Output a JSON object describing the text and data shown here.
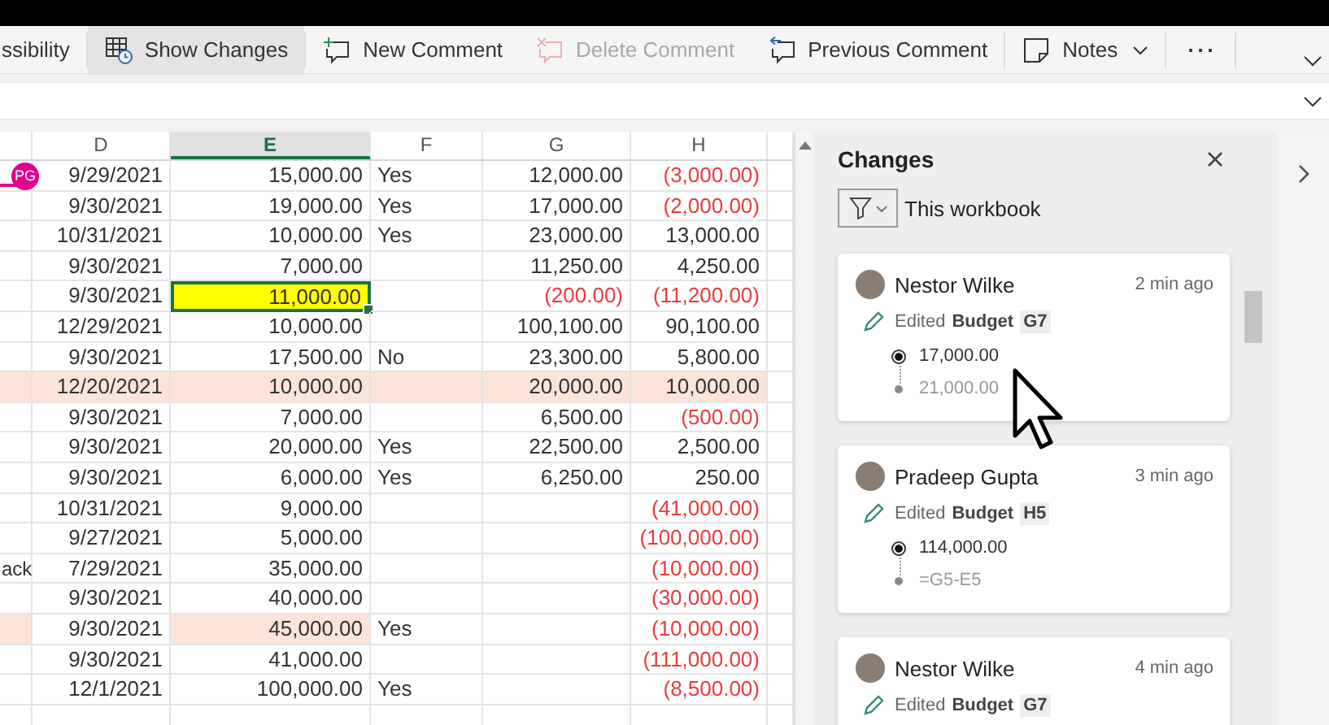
{
  "ribbon": {
    "cut_label": "ssibility",
    "buttons": [
      {
        "kind": "changes",
        "label": "Show Changes",
        "selected": true,
        "disabled": false
      },
      {
        "kind": "new-comment",
        "label": "New Comment",
        "selected": false,
        "disabled": false
      },
      {
        "kind": "delete-comment",
        "label": "Delete Comment",
        "selected": false,
        "disabled": true
      },
      {
        "kind": "previous-comment",
        "label": "Previous Comment",
        "selected": false,
        "disabled": false
      },
      {
        "kind": "notes",
        "label": "Notes",
        "selected": false,
        "disabled": false
      }
    ],
    "more": "⋯"
  },
  "sheet": {
    "columns": [
      {
        "selected": false
      },
      {
        "label": "D",
        "selected": false
      },
      {
        "label": "E",
        "selected": true
      },
      {
        "label": "F",
        "selected": false
      },
      {
        "label": "G",
        "selected": false
      },
      {
        "label": "H",
        "selected": false
      }
    ],
    "rows": [
      {
        "presence": {
          "initials": "PG"
        },
        "cells": [
          {
            "highlighted": false,
            "selected": false
          },
          {
            "text": "9/29/2021",
            "negative": false,
            "highlighted": false,
            "selected": false
          },
          {
            "text": "15,000.00",
            "negative": false,
            "highlighted": false,
            "selected": false
          },
          {
            "text": "Yes",
            "negative": false,
            "highlighted": false,
            "selected": false
          },
          {
            "text": "12,000.00",
            "negative": false,
            "highlighted": false,
            "selected": false
          },
          {
            "text": "(3,000.00)",
            "negative": true,
            "highlighted": false,
            "selected": false
          }
        ]
      },
      {
        "cells": [
          {
            "highlighted": false,
            "selected": false
          },
          {
            "text": "9/30/2021",
            "negative": false,
            "highlighted": false,
            "selected": false
          },
          {
            "text": "19,000.00",
            "negative": false,
            "highlighted": false,
            "selected": false
          },
          {
            "text": "Yes",
            "negative": false,
            "highlighted": false,
            "selected": false
          },
          {
            "text": "17,000.00",
            "negative": false,
            "highlighted": false,
            "selected": false
          },
          {
            "text": "(2,000.00)",
            "negative": true,
            "highlighted": false,
            "selected": false
          }
        ]
      },
      {
        "cells": [
          {
            "highlighted": false,
            "selected": false
          },
          {
            "text": "10/31/2021",
            "negative": false,
            "highlighted": false,
            "selected": false
          },
          {
            "text": "10,000.00",
            "negative": false,
            "highlighted": false,
            "selected": false
          },
          {
            "text": "Yes",
            "negative": false,
            "highlighted": false,
            "selected": false
          },
          {
            "text": "23,000.00",
            "negative": false,
            "highlighted": false,
            "selected": false
          },
          {
            "text": "13,000.00",
            "negative": false,
            "highlighted": false,
            "selected": false
          }
        ]
      },
      {
        "cells": [
          {
            "highlighted": false,
            "selected": false
          },
          {
            "text": "9/30/2021",
            "negative": false,
            "highlighted": false,
            "selected": false
          },
          {
            "text": "7,000.00",
            "negative": false,
            "highlighted": false,
            "selected": false
          },
          {
            "highlighted": false,
            "selected": false
          },
          {
            "text": "11,250.00",
            "negative": false,
            "highlighted": false,
            "selected": false
          },
          {
            "text": "4,250.00",
            "negative": false,
            "highlighted": false,
            "selected": false
          }
        ]
      },
      {
        "cells": [
          {
            "highlighted": false,
            "selected": false
          },
          {
            "text": "9/30/2021",
            "negative": false,
            "highlighted": false,
            "selected": false
          },
          {
            "text": "11,000.00",
            "negative": false,
            "highlighted": false,
            "selected": true
          },
          {
            "highlighted": false,
            "selected": false
          },
          {
            "text": "(200.00)",
            "negative": true,
            "highlighted": false,
            "selected": false
          },
          {
            "text": "(11,200.00)",
            "negative": true,
            "highlighted": false,
            "selected": false
          }
        ]
      },
      {
        "cells": [
          {
            "highlighted": false,
            "selected": false
          },
          {
            "text": "12/29/2021",
            "negative": false,
            "highlighted": false,
            "selected": false
          },
          {
            "text": "10,000.00",
            "negative": false,
            "highlighted": false,
            "selected": false
          },
          {
            "highlighted": false,
            "selected": false
          },
          {
            "text": "100,100.00",
            "negative": false,
            "highlighted": false,
            "selected": false
          },
          {
            "text": "90,100.00",
            "negative": false,
            "highlighted": false,
            "selected": false
          }
        ]
      },
      {
        "cells": [
          {
            "highlighted": false,
            "selected": false
          },
          {
            "text": "9/30/2021",
            "negative": false,
            "highlighted": false,
            "selected": false
          },
          {
            "text": "17,500.00",
            "negative": false,
            "highlighted": false,
            "selected": false
          },
          {
            "text": "No",
            "negative": false,
            "highlighted": false,
            "selected": false
          },
          {
            "text": "23,300.00",
            "negative": false,
            "highlighted": false,
            "selected": false
          },
          {
            "text": "5,800.00",
            "negative": false,
            "highlighted": false,
            "selected": false
          }
        ]
      },
      {
        "cells": [
          {
            "highlighted": true,
            "selected": false
          },
          {
            "text": "12/20/2021",
            "negative": false,
            "highlighted": true,
            "selected": false
          },
          {
            "text": "10,000.00",
            "negative": false,
            "highlighted": true,
            "selected": false
          },
          {
            "highlighted": true,
            "selected": false
          },
          {
            "text": "20,000.00",
            "negative": false,
            "highlighted": true,
            "selected": false
          },
          {
            "text": "10,000.00",
            "negative": false,
            "highlighted": true,
            "selected": false
          }
        ]
      },
      {
        "cells": [
          {
            "highlighted": false,
            "selected": false
          },
          {
            "text": "9/30/2021",
            "negative": false,
            "highlighted": false,
            "selected": false
          },
          {
            "text": "7,000.00",
            "negative": false,
            "highlighted": false,
            "selected": false
          },
          {
            "highlighted": false,
            "selected": false
          },
          {
            "text": "6,500.00",
            "negative": false,
            "highlighted": false,
            "selected": false
          },
          {
            "text": "(500.00)",
            "negative": true,
            "highlighted": false,
            "selected": false
          }
        ]
      },
      {
        "cells": [
          {
            "highlighted": false,
            "selected": false
          },
          {
            "text": "9/30/2021",
            "negative": false,
            "highlighted": false,
            "selected": false
          },
          {
            "text": "20,000.00",
            "negative": false,
            "highlighted": false,
            "selected": false
          },
          {
            "text": "Yes",
            "negative": false,
            "highlighted": false,
            "selected": false
          },
          {
            "text": "22,500.00",
            "negative": false,
            "highlighted": false,
            "selected": false
          },
          {
            "text": "2,500.00",
            "negative": false,
            "highlighted": false,
            "selected": false
          }
        ]
      },
      {
        "cells": [
          {
            "highlighted": false,
            "selected": false
          },
          {
            "text": "9/30/2021",
            "negative": false,
            "highlighted": false,
            "selected": false
          },
          {
            "text": "6,000.00",
            "negative": false,
            "highlighted": false,
            "selected": false
          },
          {
            "text": "Yes",
            "negative": false,
            "highlighted": false,
            "selected": false
          },
          {
            "text": "6,250.00",
            "negative": false,
            "highlighted": false,
            "selected": false
          },
          {
            "text": "250.00",
            "negative": false,
            "highlighted": false,
            "selected": false
          }
        ]
      },
      {
        "cells": [
          {
            "highlighted": false,
            "selected": false
          },
          {
            "text": "10/31/2021",
            "negative": false,
            "highlighted": false,
            "selected": false
          },
          {
            "text": "9,000.00",
            "negative": false,
            "highlighted": false,
            "selected": false
          },
          {
            "highlighted": false,
            "selected": false
          },
          {
            "highlighted": false,
            "selected": false
          },
          {
            "text": "(41,000.00)",
            "negative": true,
            "highlighted": false,
            "selected": false
          }
        ]
      },
      {
        "cells": [
          {
            "highlighted": false,
            "selected": false
          },
          {
            "text": "9/27/2021",
            "negative": false,
            "highlighted": false,
            "selected": false
          },
          {
            "text": "5,000.00",
            "negative": false,
            "highlighted": false,
            "selected": false
          },
          {
            "highlighted": false,
            "selected": false
          },
          {
            "highlighted": false,
            "selected": false
          },
          {
            "text": "(100,000.00)",
            "negative": true,
            "highlighted": false,
            "selected": false
          }
        ]
      },
      {
        "cells": [
          {
            "text": "ack",
            "negative": false,
            "highlighted": false,
            "selected": false
          },
          {
            "text": "7/29/2021",
            "negative": false,
            "highlighted": false,
            "selected": false
          },
          {
            "text": "35,000.00",
            "negative": false,
            "highlighted": false,
            "selected": false
          },
          {
            "highlighted": false,
            "selected": false
          },
          {
            "highlighted": false,
            "selected": false
          },
          {
            "text": "(10,000.00)",
            "negative": true,
            "highlighted": false,
            "selected": false
          }
        ]
      },
      {
        "cells": [
          {
            "highlighted": false,
            "selected": false
          },
          {
            "text": "9/30/2021",
            "negative": false,
            "highlighted": false,
            "selected": false
          },
          {
            "text": "40,000.00",
            "negative": false,
            "highlighted": false,
            "selected": false
          },
          {
            "highlighted": false,
            "selected": false
          },
          {
            "highlighted": false,
            "selected": false
          },
          {
            "text": "(30,000.00)",
            "negative": true,
            "highlighted": false,
            "selected": false
          }
        ]
      },
      {
        "cells": [
          {
            "highlighted": true,
            "selected": false
          },
          {
            "text": "9/30/2021",
            "negative": false,
            "highlighted": false,
            "selected": false
          },
          {
            "text": "45,000.00",
            "negative": false,
            "highlighted": true,
            "selected": false
          },
          {
            "text": "Yes",
            "negative": false,
            "highlighted": false,
            "selected": false
          },
          {
            "highlighted": false,
            "selected": false
          },
          {
            "text": "(10,000.00)",
            "negative": true,
            "highlighted": false,
            "selected": false
          }
        ]
      },
      {
        "cells": [
          {
            "highlighted": false,
            "selected": false
          },
          {
            "text": "9/30/2021",
            "negative": false,
            "highlighted": false,
            "selected": false
          },
          {
            "text": "41,000.00",
            "negative": false,
            "highlighted": false,
            "selected": false
          },
          {
            "highlighted": false,
            "selected": false
          },
          {
            "highlighted": false,
            "selected": false
          },
          {
            "text": "(111,000.00)",
            "negative": true,
            "highlighted": false,
            "selected": false
          }
        ]
      },
      {
        "cells": [
          {
            "highlighted": false,
            "selected": false
          },
          {
            "text": "12/1/2021",
            "negative": false,
            "highlighted": false,
            "selected": false
          },
          {
            "text": "100,000.00",
            "negative": false,
            "highlighted": false,
            "selected": false
          },
          {
            "text": "Yes",
            "negative": false,
            "highlighted": false,
            "selected": false
          },
          {
            "highlighted": false,
            "selected": false
          },
          {
            "text": "(8,500.00)",
            "negative": true,
            "highlighted": false,
            "selected": false
          }
        ]
      }
    ]
  },
  "changes_panel": {
    "title": "Changes",
    "filter": "This workbook",
    "cards": [
      {
        "author": "Nestor Wilke",
        "time": "2 min ago",
        "action": "Edited",
        "sheet": "Budget",
        "cell": "G7",
        "new_value": "17,000.00",
        "old_value": "21,000.00"
      },
      {
        "author": "Pradeep Gupta",
        "time": "3 min ago",
        "action": "Edited",
        "sheet": "Budget",
        "cell": "H5",
        "new_value": "114,000.00",
        "old_value": "=G5-E5"
      },
      {
        "author": "Nestor Wilke",
        "time": "4 min ago",
        "action": "Edited",
        "sheet": "Budget",
        "cell": "G7"
      }
    ]
  }
}
